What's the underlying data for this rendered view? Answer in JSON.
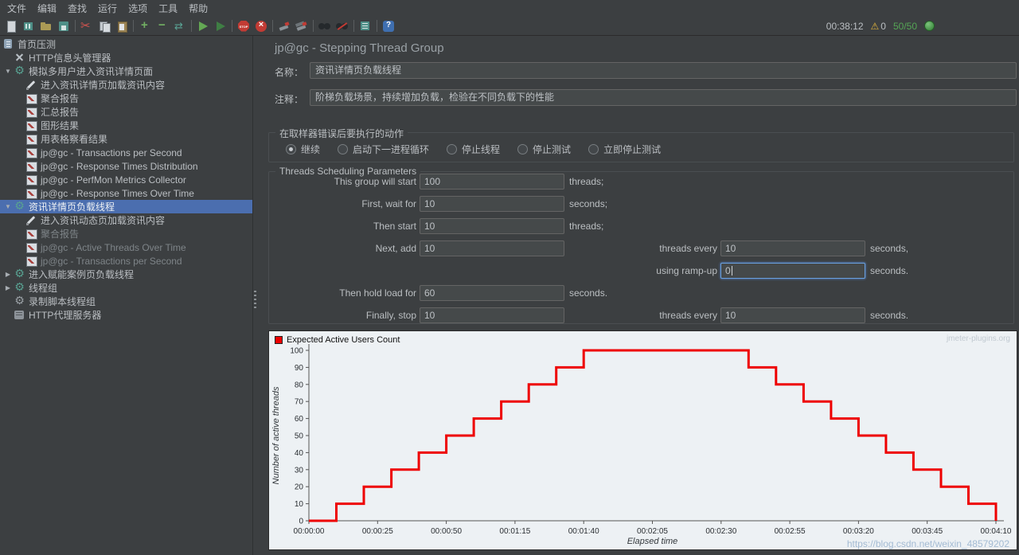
{
  "menu": {
    "items": [
      "文件",
      "编辑",
      "查找",
      "运行",
      "选项",
      "工具",
      "帮助"
    ]
  },
  "toolbar": {
    "groups": [
      [
        "new",
        "templates",
        "open",
        "save"
      ],
      [
        "cut",
        "copy",
        "paste"
      ],
      [
        "expand-all",
        "collapse-all",
        "toggle"
      ],
      [
        "start",
        "start-no-pauses"
      ],
      [
        "stop",
        "shutdown"
      ],
      [
        "clear",
        "clear-all"
      ],
      [
        "search",
        "search-reset"
      ],
      [
        "function-helper"
      ],
      [
        "help"
      ]
    ],
    "status": {
      "elapsed": "00:38:12",
      "warning_count": "0",
      "threads": "50/50"
    }
  },
  "tree": {
    "items": [
      {
        "label": "首页压测",
        "depth": 0,
        "icon": "plan"
      },
      {
        "label": "HTTP信息头管理器",
        "depth": 1,
        "icon": "header"
      },
      {
        "label": "模拟多用户进入资讯详情页面",
        "depth": 1,
        "icon": "gear",
        "arrow": "down"
      },
      {
        "label": "进入资讯详情页加载资讯内容",
        "depth": 2,
        "icon": "pencil"
      },
      {
        "label": "聚合报告",
        "depth": 2,
        "icon": "listener"
      },
      {
        "label": "汇总报告",
        "depth": 2,
        "icon": "listener"
      },
      {
        "label": "图形结果",
        "depth": 2,
        "icon": "listener"
      },
      {
        "label": "用表格察看结果",
        "depth": 2,
        "icon": "listener"
      },
      {
        "label": "jp@gc - Transactions per Second",
        "depth": 2,
        "icon": "listener"
      },
      {
        "label": "jp@gc - Response Times Distribution",
        "depth": 2,
        "icon": "listener"
      },
      {
        "label": "jp@gc - PerfMon Metrics Collector",
        "depth": 2,
        "icon": "listener"
      },
      {
        "label": "jp@gc - Response Times Over Time",
        "depth": 2,
        "icon": "listener"
      },
      {
        "label": "资讯详情页负载线程",
        "depth": 1,
        "icon": "gear",
        "arrow": "down",
        "selected": true
      },
      {
        "label": "进入资讯动态页加载资讯内容",
        "depth": 2,
        "icon": "pencil"
      },
      {
        "label": "聚合报告",
        "depth": 2,
        "icon": "listener",
        "disabled": true
      },
      {
        "label": "jp@gc - Active Threads Over Time",
        "depth": 2,
        "icon": "listener",
        "disabled": true
      },
      {
        "label": "jp@gc - Transactions per Second",
        "depth": 2,
        "icon": "listener",
        "disabled": true
      },
      {
        "label": "进入赋能案例页负载线程",
        "depth": 1,
        "icon": "gear",
        "arrow": "right"
      },
      {
        "label": "线程组",
        "depth": 1,
        "icon": "gear",
        "arrow": "right"
      },
      {
        "label": "录制脚本线程组",
        "depth": 1,
        "icon": "gear-gray"
      },
      {
        "label": "HTTP代理服务器",
        "depth": 1,
        "icon": "proxy"
      }
    ]
  },
  "main": {
    "title": "jp@gc - Stepping Thread Group",
    "name_label": "名称：",
    "name_value": "资讯详情页负载线程",
    "comment_label": "注释：",
    "comment_value": "阶梯负载场景，持续增加负载，检验在不同负载下的性能",
    "error_action": {
      "title": "在取样器错误后要执行的动作",
      "options": [
        {
          "label": "继续",
          "selected": true
        },
        {
          "label": "启动下一进程循环",
          "selected": false
        },
        {
          "label": "停止线程",
          "selected": false
        },
        {
          "label": "停止测试",
          "selected": false
        },
        {
          "label": "立即停止测试",
          "selected": false
        }
      ]
    },
    "scheduling": {
      "group_title": "Threads Scheduling Parameters",
      "rows": [
        {
          "label": "This group will start",
          "value": "100",
          "suffix": "threads;"
        },
        {
          "label": "First, wait for",
          "value": "10",
          "suffix": "seconds;"
        },
        {
          "label": "Then start",
          "value": "10",
          "suffix": "threads;"
        },
        {
          "label": "Next, add",
          "value": "10",
          "label2": "threads every",
          "value2": "10",
          "suffix2": "seconds,"
        },
        {
          "label2": "using ramp-up",
          "value2": "0",
          "suffix2": "seconds.",
          "focused": true
        },
        {
          "label": "Then hold load for",
          "value": "60",
          "suffix": "seconds."
        },
        {
          "label": "Finally, stop",
          "value": "10",
          "label2": "threads every",
          "value2": "10",
          "suffix2": "seconds."
        }
      ]
    }
  },
  "chart_data": {
    "type": "line",
    "title": "Expected Active Users Count",
    "legend_label": "Expected Active Users Count",
    "line_color": "#ee0000",
    "xlabel": "Elapsed time",
    "ylabel": "Number of active threads",
    "xlim_seconds": [
      0,
      250
    ],
    "ylim": [
      0,
      100
    ],
    "y_ticks": [
      0,
      10,
      20,
      30,
      40,
      50,
      60,
      70,
      80,
      90,
      100
    ],
    "x_ticks": [
      {
        "t": 0,
        "label": "00:00:00"
      },
      {
        "t": 25,
        "label": "00:00:25"
      },
      {
        "t": 50,
        "label": "00:00:50"
      },
      {
        "t": 75,
        "label": "00:01:15"
      },
      {
        "t": 100,
        "label": "00:01:40"
      },
      {
        "t": 125,
        "label": "00:02:05"
      },
      {
        "t": 150,
        "label": "00:02:30"
      },
      {
        "t": 175,
        "label": "00:02:55"
      },
      {
        "t": 200,
        "label": "00:03:20"
      },
      {
        "t": 225,
        "label": "00:03:45"
      },
      {
        "t": 250,
        "label": "00:04:10"
      }
    ],
    "points": [
      [
        0,
        0
      ],
      [
        10,
        0
      ],
      [
        10,
        10
      ],
      [
        20,
        10
      ],
      [
        20,
        20
      ],
      [
        30,
        20
      ],
      [
        30,
        30
      ],
      [
        40,
        30
      ],
      [
        40,
        40
      ],
      [
        50,
        40
      ],
      [
        50,
        50
      ],
      [
        60,
        50
      ],
      [
        60,
        60
      ],
      [
        70,
        60
      ],
      [
        70,
        70
      ],
      [
        80,
        70
      ],
      [
        80,
        80
      ],
      [
        90,
        80
      ],
      [
        90,
        90
      ],
      [
        100,
        90
      ],
      [
        100,
        100
      ],
      [
        160,
        100
      ],
      [
        160,
        90
      ],
      [
        170,
        90
      ],
      [
        170,
        80
      ],
      [
        180,
        80
      ],
      [
        180,
        70
      ],
      [
        190,
        70
      ],
      [
        190,
        60
      ],
      [
        200,
        60
      ],
      [
        200,
        50
      ],
      [
        210,
        50
      ],
      [
        210,
        40
      ],
      [
        220,
        40
      ],
      [
        220,
        30
      ],
      [
        230,
        30
      ],
      [
        230,
        20
      ],
      [
        240,
        20
      ],
      [
        240,
        10
      ],
      [
        250,
        10
      ],
      [
        250,
        0
      ]
    ],
    "watermark": "jmeter-plugins.org"
  },
  "watermarks": {
    "csdn": "https://blog.csdn.net/weixin_48579202"
  }
}
